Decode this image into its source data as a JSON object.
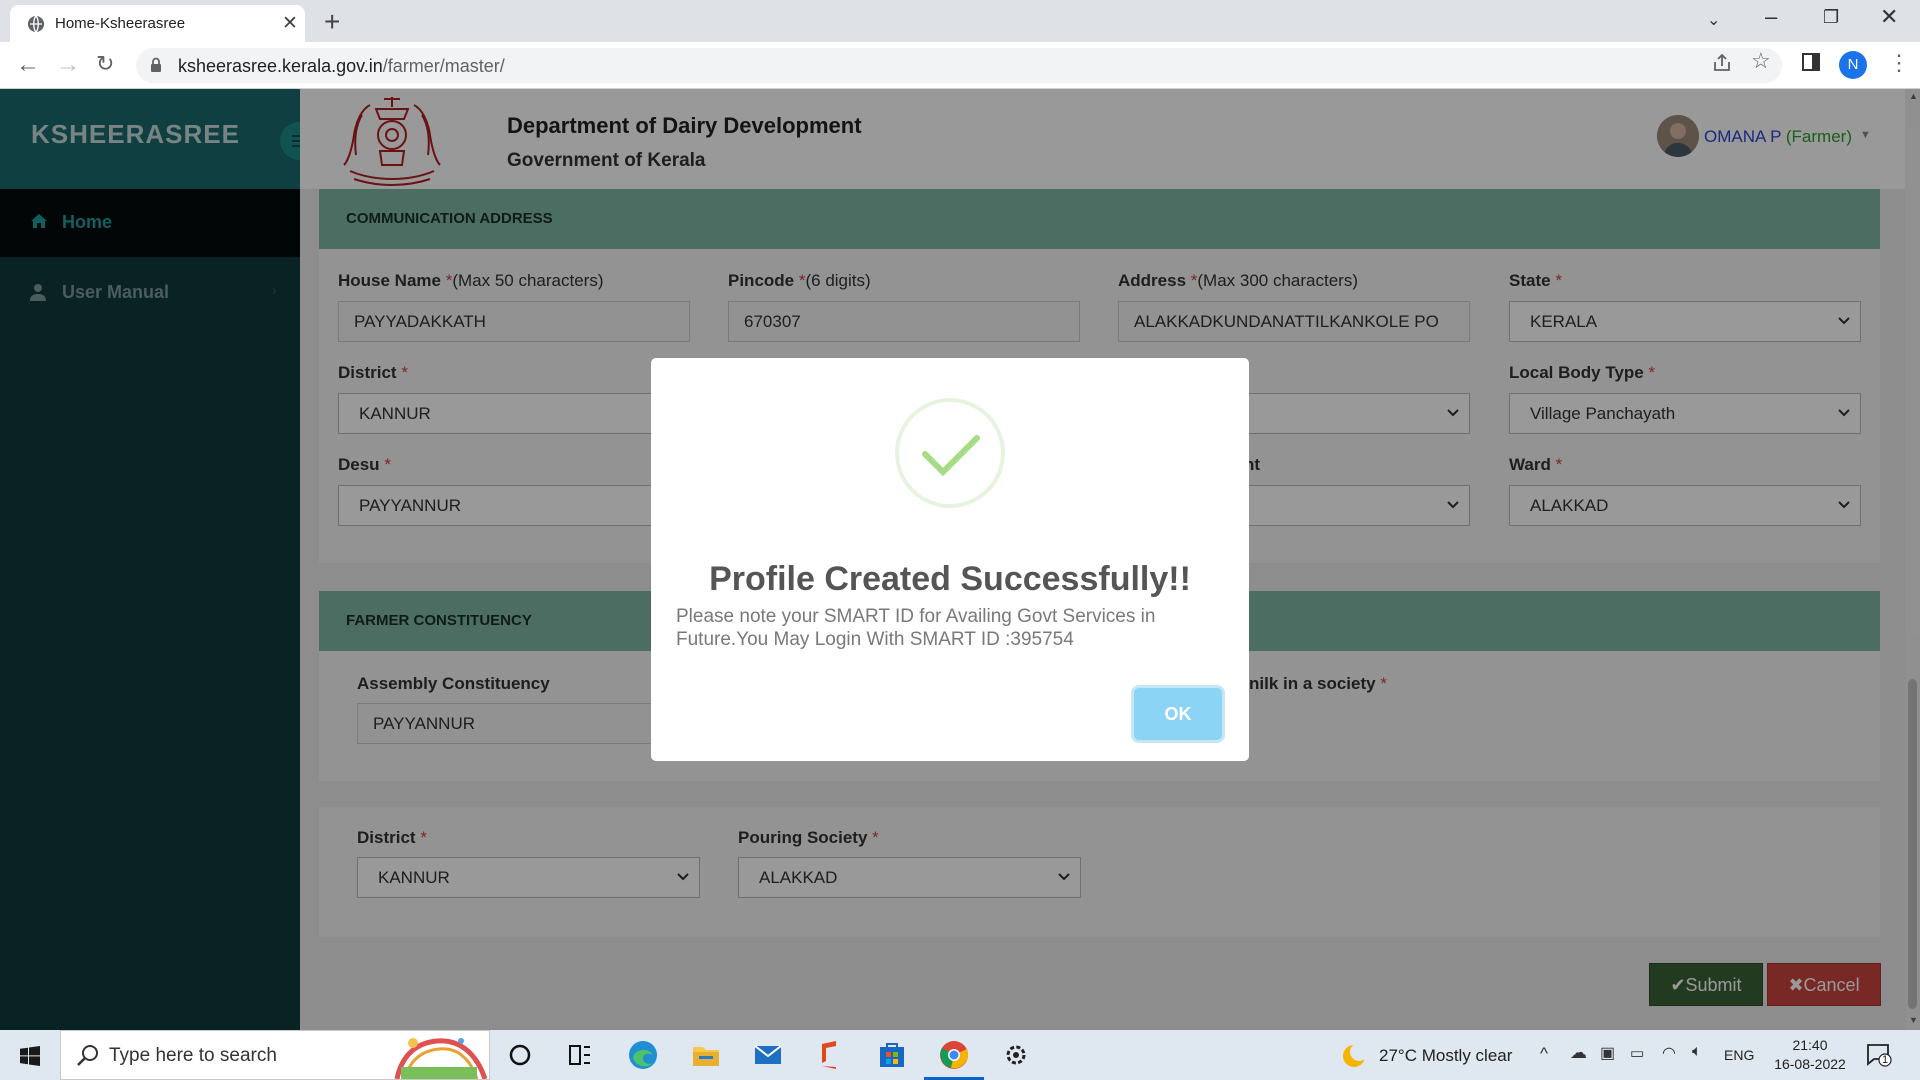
{
  "browser": {
    "tab_title": "Home-Ksheerasree",
    "url_host": "ksheerasree.kerala.gov.in",
    "url_path": "/farmer/master/",
    "profile_initial": "N"
  },
  "site": {
    "brand": "KSHEERASREE",
    "department": "Department of Dairy Development",
    "government": "Government of Kerala",
    "user_name": "OMANA P",
    "user_role": "(Farmer)"
  },
  "sidebar": {
    "items": [
      {
        "label": "Home"
      },
      {
        "label": "User Manual"
      }
    ]
  },
  "communication_address": {
    "heading": "COMMUNICATION ADDRESS",
    "house_name": {
      "label": "House Name",
      "hint": "(Max 50 characters)",
      "value": "PAYYADAKKATH"
    },
    "pincode": {
      "label": "Pincode",
      "hint": "(6 digits)",
      "value": "670307"
    },
    "address": {
      "label": "Address",
      "hint": "(Max 300 characters)",
      "value": "ALAKKADKUNDANATTILKANKOLE PO"
    },
    "state": {
      "label": "State",
      "value": "KERALA"
    },
    "district": {
      "label": "District",
      "value": "KANNUR"
    },
    "local_body_type": {
      "label": "Local Body Type",
      "value": "Village Panchayath"
    },
    "desu": {
      "label": "Desu",
      "value": "PAYYANNUR"
    },
    "partial_label": "nt",
    "ward": {
      "label": "Ward",
      "value": "ALAKKAD"
    }
  },
  "farmer_constituency": {
    "heading": "FARMER CONSTITUENCY",
    "assembly": {
      "label": "Assembly Constituency",
      "value": "PAYYANNUR"
    },
    "partial_label": "nilk in a society"
  },
  "pouring": {
    "district": {
      "label": "District",
      "value": "KANNUR"
    },
    "society": {
      "label": "Pouring Society",
      "value": "ALAKKAD"
    }
  },
  "required_mark": "*",
  "buttons": {
    "submit": "Submit",
    "cancel": "Cancel"
  },
  "modal": {
    "title": "Profile Created Successfully!!",
    "message": "Please note your SMART ID for Availing Govt Services in Future.You May Login With SMART ID :395754",
    "ok": "OK"
  },
  "taskbar": {
    "search_placeholder": "Type here to search",
    "weather": "27°C  Mostly clear",
    "language": "ENG",
    "time": "21:40",
    "date": "16-08-2022",
    "notifications": "1"
  },
  "colors": {
    "sidebar": "#0f3b3e",
    "brand_bar": "#1a6a6b",
    "panel_head": "#7fb8a4",
    "submit": "#396336",
    "cancel": "#c9443f",
    "ok_button": "#8cd4f5"
  }
}
